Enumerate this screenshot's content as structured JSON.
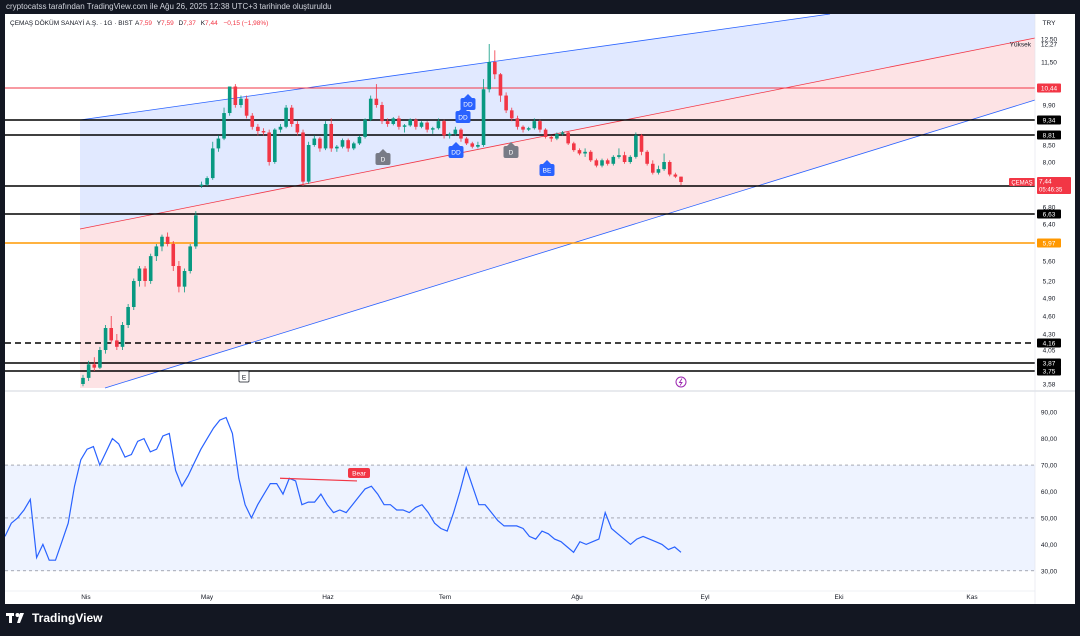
{
  "header": {
    "caption": "cryptocatss tarafından TradingView.com ile Ağu 26, 2025 12:38 UTC+3 tarihinde oluşturuldu",
    "symbol": "ÇEMAŞ DÖKÜM SANAYİ A.Ş. · 1G · BIST",
    "o_label": "A",
    "o_value": "7,59",
    "h_label": "Y",
    "h_value": "7,59",
    "l_label": "D",
    "l_value": "7,37",
    "c_label": "K",
    "c_value": "7,44",
    "change": "−0,15 (−1,98%)"
  },
  "price_axis": {
    "currency": "TRY",
    "ticks": [
      "12,50",
      "11,50",
      "9,90",
      "8,50",
      "8,00",
      "6,80",
      "6,40",
      "6,00",
      "5,60",
      "5,20",
      "4,90",
      "4,60",
      "4,30",
      "4,05",
      "3,58"
    ],
    "high_label": "Yüksek",
    "high_value": "12,27",
    "ticker_tag": "ÇEMAŞ",
    "last_price": "7,44",
    "countdown": "05:46:35"
  },
  "level_tags": [
    {
      "value": "10,44",
      "color": "#f23645",
      "style": "solid"
    },
    {
      "value": "9,34",
      "color": "#000000",
      "style": "solid"
    },
    {
      "value": "8,81",
      "color": "#000000",
      "style": "solid"
    },
    {
      "value": "7,35",
      "color": "#000000",
      "style": "solid"
    },
    {
      "value": "6,63",
      "color": "#000000",
      "style": "solid"
    },
    {
      "value": "5,97",
      "color": "#ff9800",
      "style": "solid"
    },
    {
      "value": "4,16",
      "color": "#000000",
      "style": "dashed"
    },
    {
      "value": "3,87",
      "color": "#000000",
      "style": "solid"
    },
    {
      "value": "3,75",
      "color": "#000000",
      "style": "solid"
    }
  ],
  "time_axis": [
    "Nis",
    "May",
    "Haz",
    "Tem",
    "Ağu",
    "Eyl",
    "Eki",
    "Kas"
  ],
  "markers": [
    {
      "text": "D",
      "color": "#787b86"
    },
    {
      "text": "DD",
      "color": "#2962ff"
    },
    {
      "text": "DD",
      "color": "#2962ff"
    },
    {
      "text": "DD",
      "color": "#2962ff"
    },
    {
      "text": "D",
      "color": "#787b86"
    },
    {
      "text": "BE",
      "color": "#2962ff"
    },
    {
      "text": "E",
      "color": "#ffffff"
    }
  ],
  "rsi": {
    "ticks": [
      "90,00",
      "80,00",
      "70,00",
      "60,00",
      "50,00",
      "40,00",
      "30,00"
    ],
    "bear_label": "Bear",
    "line_color": "#2962ff"
  },
  "branding": {
    "name": "TradingView"
  },
  "chart_data": [
    {
      "type": "candlestick",
      "series": [
        {
          "name": "ÇEMAŞ"
        }
      ],
      "xlim": [
        "Mar 20 2025",
        "Nov 12 2025"
      ],
      "candles": [
        [
          3.58,
          3.7,
          3.55,
          3.66
        ],
        [
          3.66,
          3.9,
          3.62,
          3.85
        ],
        [
          3.85,
          3.95,
          3.75,
          3.8
        ],
        [
          3.8,
          4.1,
          3.78,
          4.05
        ],
        [
          4.05,
          4.45,
          4.0,
          4.4
        ],
        [
          4.4,
          4.6,
          4.15,
          4.2
        ],
        [
          4.2,
          4.3,
          4.05,
          4.1
        ],
        [
          4.1,
          4.5,
          4.05,
          4.45
        ],
        [
          4.45,
          4.8,
          4.4,
          4.75
        ],
        [
          4.75,
          5.25,
          4.7,
          5.2
        ],
        [
          5.2,
          5.5,
          5.1,
          5.45
        ],
        [
          5.45,
          5.5,
          5.1,
          5.2
        ],
        [
          5.2,
          5.75,
          5.15,
          5.7
        ],
        [
          5.7,
          5.95,
          5.6,
          5.9
        ],
        [
          5.9,
          6.15,
          5.8,
          6.1
        ],
        [
          6.1,
          6.2,
          5.9,
          5.95
        ],
        [
          5.95,
          6.0,
          5.4,
          5.5
        ],
        [
          5.5,
          5.6,
          5.0,
          5.1
        ],
        [
          5.1,
          5.45,
          5.0,
          5.4
        ],
        [
          5.4,
          5.95,
          5.35,
          5.9
        ],
        [
          5.9,
          6.7,
          5.85,
          6.6
        ],
        [
          7.35,
          7.45,
          7.3,
          7.38
        ],
        [
          7.38,
          7.6,
          7.35,
          7.55
        ],
        [
          7.55,
          8.6,
          7.5,
          8.4
        ],
        [
          8.4,
          8.8,
          8.3,
          8.7
        ],
        [
          8.7,
          9.8,
          8.65,
          9.6
        ],
        [
          9.6,
          10.5,
          9.5,
          10.5
        ],
        [
          10.5,
          10.6,
          9.8,
          9.9
        ],
        [
          9.9,
          10.2,
          9.8,
          10.1
        ],
        [
          10.1,
          10.2,
          9.4,
          9.5
        ],
        [
          9.5,
          9.6,
          9.0,
          9.1
        ],
        [
          9.1,
          9.2,
          8.8,
          8.95
        ],
        [
          8.95,
          9.05,
          8.8,
          8.9
        ],
        [
          8.9,
          9.0,
          7.9,
          8.0
        ],
        [
          8.0,
          9.05,
          7.95,
          9.0
        ],
        [
          9.0,
          9.2,
          8.9,
          9.1
        ],
        [
          9.1,
          9.9,
          9.05,
          9.8
        ],
        [
          9.8,
          9.9,
          9.1,
          9.2
        ],
        [
          9.2,
          9.3,
          8.8,
          8.9
        ],
        [
          8.9,
          9.0,
          7.35,
          7.45
        ],
        [
          7.45,
          8.6,
          7.4,
          8.5
        ],
        [
          8.5,
          8.8,
          8.45,
          8.7
        ],
        [
          8.7,
          8.75,
          8.3,
          8.4
        ],
        [
          8.4,
          9.3,
          8.35,
          9.2
        ],
        [
          9.2,
          9.4,
          8.3,
          8.4
        ],
        [
          8.4,
          8.5,
          8.3,
          8.45
        ],
        [
          8.45,
          8.7,
          8.4,
          8.65
        ],
        [
          8.65,
          8.7,
          8.3,
          8.4
        ],
        [
          8.4,
          8.6,
          8.35,
          8.55
        ],
        [
          8.55,
          8.8,
          8.5,
          8.75
        ],
        [
          8.75,
          9.4,
          8.7,
          9.35
        ],
        [
          9.35,
          10.2,
          9.3,
          10.1
        ],
        [
          10.1,
          10.6,
          9.8,
          9.9
        ],
        [
          9.9,
          10.0,
          9.2,
          9.3
        ],
        [
          9.3,
          9.4,
          9.1,
          9.2
        ],
        [
          9.2,
          9.45,
          9.15,
          9.4
        ],
        [
          9.4,
          9.5,
          9.0,
          9.1
        ],
        [
          9.1,
          9.2,
          8.9,
          9.15
        ],
        [
          9.15,
          9.4,
          9.1,
          9.35
        ],
        [
          9.35,
          9.4,
          9.0,
          9.1
        ],
        [
          9.1,
          9.3,
          9.05,
          9.25
        ],
        [
          9.25,
          9.3,
          8.9,
          9.0
        ],
        [
          9.0,
          9.1,
          8.85,
          9.05
        ],
        [
          9.05,
          9.4,
          9.0,
          9.3
        ],
        [
          9.3,
          9.35,
          8.7,
          8.8
        ],
        [
          8.8,
          8.9,
          8.7,
          8.85
        ],
        [
          8.85,
          9.1,
          8.8,
          9.0
        ],
        [
          9.0,
          9.05,
          8.6,
          8.7
        ],
        [
          8.7,
          8.75,
          8.5,
          8.55
        ],
        [
          8.55,
          8.6,
          8.4,
          8.45
        ],
        [
          8.45,
          8.6,
          8.4,
          8.5
        ],
        [
          8.5,
          10.8,
          8.45,
          10.4
        ],
        [
          10.4,
          12.27,
          10.3,
          11.5
        ],
        [
          11.5,
          12.0,
          10.8,
          11.0
        ],
        [
          11.0,
          11.05,
          10.0,
          10.2
        ],
        [
          10.2,
          10.3,
          9.6,
          9.7
        ],
        [
          9.7,
          9.8,
          9.3,
          9.4
        ],
        [
          9.4,
          9.5,
          9.0,
          9.1
        ],
        [
          9.1,
          9.15,
          8.9,
          9.0
        ],
        [
          9.0,
          9.1,
          8.95,
          9.05
        ],
        [
          9.05,
          9.4,
          9.0,
          9.3
        ],
        [
          9.3,
          9.35,
          8.9,
          9.0
        ],
        [
          9.0,
          9.05,
          8.7,
          8.75
        ],
        [
          8.75,
          8.8,
          8.6,
          8.7
        ],
        [
          8.7,
          8.9,
          8.65,
          8.85
        ],
        [
          8.85,
          8.95,
          8.8,
          8.9
        ],
        [
          8.9,
          8.95,
          8.5,
          8.55
        ],
        [
          8.55,
          8.6,
          8.3,
          8.35
        ],
        [
          8.35,
          8.4,
          8.2,
          8.25
        ],
        [
          8.25,
          8.4,
          8.15,
          8.3
        ],
        [
          8.3,
          8.35,
          8.0,
          8.05
        ],
        [
          8.05,
          8.1,
          7.85,
          7.9
        ],
        [
          7.9,
          8.1,
          7.85,
          8.05
        ],
        [
          8.05,
          8.1,
          7.9,
          7.95
        ],
        [
          7.95,
          8.2,
          7.9,
          8.15
        ],
        [
          8.15,
          8.4,
          8.1,
          8.2
        ],
        [
          8.2,
          8.3,
          7.95,
          8.0
        ],
        [
          8.0,
          8.2,
          7.95,
          8.15
        ],
        [
          8.15,
          8.9,
          8.1,
          8.8
        ],
        [
          8.8,
          8.85,
          8.2,
          8.3
        ],
        [
          8.3,
          8.35,
          7.9,
          7.95
        ],
        [
          7.95,
          8.05,
          7.65,
          7.7
        ],
        [
          7.7,
          7.9,
          7.65,
          7.8
        ],
        [
          7.8,
          8.25,
          7.75,
          8.0
        ],
        [
          8.0,
          8.05,
          7.6,
          7.65
        ],
        [
          7.65,
          7.7,
          7.55,
          7.59
        ],
        [
          7.59,
          7.59,
          7.37,
          7.44
        ]
      ]
    },
    {
      "type": "line",
      "series": [
        {
          "name": "RSI"
        }
      ],
      "ylim": [
        25,
        95
      ],
      "values": [
        43,
        48,
        50,
        53,
        57,
        35,
        40,
        34,
        34,
        41,
        48,
        62,
        72,
        76,
        77,
        70,
        75,
        80,
        78,
        73,
        74,
        79,
        80,
        75,
        76,
        81,
        82,
        68,
        62,
        66,
        71,
        76,
        80,
        84,
        87,
        88,
        82,
        65,
        55,
        50,
        55,
        59,
        63,
        63,
        59,
        65,
        64,
        55,
        56,
        56,
        59,
        55,
        52,
        53,
        52,
        55,
        58,
        61,
        62,
        59,
        55,
        55,
        53,
        53,
        52,
        54,
        55,
        52,
        48,
        46,
        45,
        52,
        60,
        69,
        62,
        55,
        55,
        52,
        49,
        47,
        47,
        47,
        46,
        43,
        42,
        45,
        44,
        42,
        41,
        39,
        37,
        41,
        40,
        41,
        42,
        52,
        46,
        44,
        42,
        40,
        42,
        43,
        42,
        41,
        40,
        38,
        39,
        37
      ]
    }
  ]
}
